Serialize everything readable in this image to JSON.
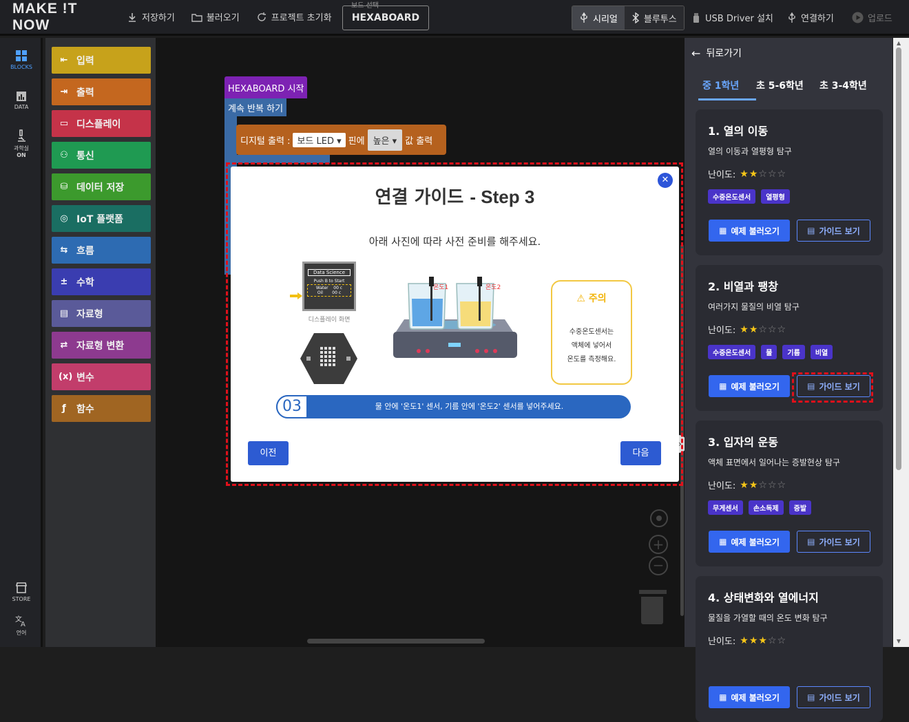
{
  "topbar": {
    "logo": "MAKE !T NOW",
    "save": "저장하기",
    "load": "불러오기",
    "reset": "프로젝트 초기화",
    "board_caption": "보드 선택",
    "board": "HEXABOARD",
    "serial": "시리얼",
    "bluetooth": "블루투스",
    "usb": "USB Driver 설치",
    "connect": "연결하기",
    "upload": "업로드"
  },
  "sidebar": {
    "blocks": "BLOCKS",
    "data": "DATA",
    "lab": "과학실",
    "lab_state": "ON",
    "store": "STORE",
    "language": "언어"
  },
  "palette": [
    {
      "label": "입력",
      "color": "#c7a21b",
      "icon": "input-icon"
    },
    {
      "label": "출력",
      "color": "#c4671f",
      "icon": "output-icon"
    },
    {
      "label": "디스플레이",
      "color": "#c53349",
      "icon": "display-icon"
    },
    {
      "label": "통신",
      "color": "#1f9a52",
      "icon": "communication-icon"
    },
    {
      "label": "데이터 저장",
      "color": "#3c9a2d",
      "icon": "data-storage-icon"
    },
    {
      "label": "IoT 플랫폼",
      "color": "#1a6e62",
      "icon": "iot-icon"
    },
    {
      "label": "흐름",
      "color": "#2d6bb2",
      "icon": "flow-icon"
    },
    {
      "label": "수학",
      "color": "#3a3db0",
      "icon": "math-icon"
    },
    {
      "label": "자료형",
      "color": "#5a5a99",
      "icon": "datatype-icon"
    },
    {
      "label": "자료형 변환",
      "color": "#8d3a8f",
      "icon": "type-conversion-icon"
    },
    {
      "label": "변수",
      "color": "#c23d6b",
      "icon": "variable-icon"
    },
    {
      "label": "함수",
      "color": "#a06522",
      "icon": "function-icon"
    }
  ],
  "workspace": {
    "start_block": "HEXABOARD 시작",
    "loop_block": "계속 반복 하기",
    "digital_out": "디지털 출력 :",
    "board_led": "보드 LED",
    "pin_text": "핀에",
    "high": "높은",
    "value_out": "값 출력"
  },
  "modal": {
    "title_main": "연결 가이드",
    "title_step": "- Step 3",
    "subtitle": "아래 사진에 따라 사전 준비를 해주세요.",
    "display_caption": "디스플레이 화면",
    "screen_title": "Data Science",
    "screen_line1": "Push B to Start",
    "screen_line2": "Water    00 c",
    "screen_line3": "Oil       00 c",
    "sensor1": "온도1",
    "sensor2": "온도2",
    "caution_title": "주의",
    "caution_text": [
      "수중온도센서는",
      "액체에 넣어서",
      "온도를 측정해요."
    ],
    "step_number": "03",
    "step_text": "물 안에 '온도1' 센서, 기름 안에 '온도2' 센서를 넣어주세요.",
    "prev": "이전",
    "next": "다음"
  },
  "panel": {
    "back": "뒤로가기",
    "tabs": [
      "중 1학년",
      "초 5-6학년",
      "초 3-4학년"
    ],
    "difficulty_label": "난이도:",
    "cards": [
      {
        "title": "1. 열의 이동",
        "desc": "열의 이동과 열평형 탐구",
        "stars": 2,
        "tags": [
          "수중온도센서",
          "열평형"
        ],
        "load": "예제 불러오기",
        "guide": "가이드 보기"
      },
      {
        "title": "2. 비열과 팽창",
        "desc": "여러가지 물질의 비열 탐구",
        "stars": 2,
        "tags": [
          "수중온도센서",
          "물",
          "기름",
          "비열"
        ],
        "load": "예제 불러오기",
        "guide": "가이드 보기"
      },
      {
        "title": "3. 입자의 운동",
        "desc": "액체 표면에서 일어나는 증발현상 탐구",
        "stars": 2,
        "tags": [
          "무게센서",
          "손소독제",
          "증발"
        ],
        "load": "예제 불러오기",
        "guide": "가이드 보기"
      },
      {
        "title": "4. 상태변화와 열에너지",
        "desc": "물질을 가열할 때의 온도 변화 탐구",
        "stars": 3,
        "tags": [],
        "load": "예제 불러오기",
        "guide": "가이드 보기"
      }
    ]
  },
  "colors": {
    "accent": "#2d5bd2",
    "tag": "#4a34c9",
    "highlight": "#e0101a"
  }
}
